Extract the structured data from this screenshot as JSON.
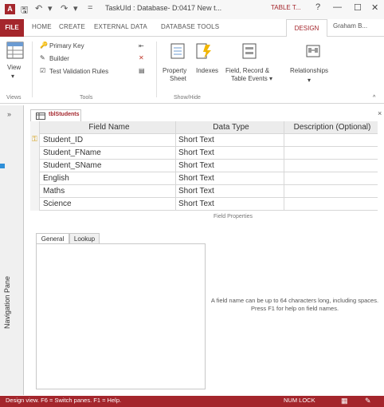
{
  "titlebar": {
    "title": "TaskUId : Database- D:0417 New t...",
    "context_tab": "TABLE T...",
    "help": "?",
    "minimize": "—",
    "maximize": "☐",
    "close": "✕"
  },
  "tabs": {
    "file": "FILE",
    "home": "HOME",
    "create": "CREATE",
    "external": "EXTERNAL DATA",
    "dbtools": "DATABASE TOOLS",
    "design": "DESIGN",
    "user": "Graham B..."
  },
  "ribbon": {
    "view": "View",
    "primary_key": "Primary Key",
    "builder": "Builder",
    "test_validation": "Test Validation Rules",
    "property_sheet_1": "Property",
    "property_sheet_2": "Sheet",
    "indexes": "Indexes",
    "field_record_1": "Field, Record &",
    "field_record_2": "Table Events ▾",
    "relationships": "Relationships",
    "group_views": "Views",
    "group_tools": "Tools",
    "group_showhide": "Show/Hide"
  },
  "nav": {
    "label": "Navigation Pane",
    "chevron": "»"
  },
  "document": {
    "tab_label": "tblStudents",
    "close": "×"
  },
  "grid": {
    "headers": [
      "Field Name",
      "Data Type",
      "Description (Optional)"
    ],
    "rows": [
      {
        "name": "Student_ID",
        "type": "Short Text",
        "key": true
      },
      {
        "name": "Student_FName",
        "type": "Short Text",
        "key": false
      },
      {
        "name": "Student_SName",
        "type": "Short Text",
        "key": false
      },
      {
        "name": "English",
        "type": "Short Text",
        "key": false
      },
      {
        "name": "Maths",
        "type": "Short Text",
        "key": false
      },
      {
        "name": "Science",
        "type": "Short Text",
        "key": false
      }
    ]
  },
  "field_properties": {
    "label": "Field Properties",
    "tab_general": "General",
    "tab_lookup": "Lookup",
    "help_text": "A field name can be up to 64 characters long, including spaces. Press F1 for help on field names."
  },
  "statusbar": {
    "left": "Design view.  F6 = Switch panes.  F1 = Help.",
    "numlock": "NUM LOCK"
  },
  "colors": {
    "accent": "#a4262c",
    "key_icon": "#d4a017"
  }
}
